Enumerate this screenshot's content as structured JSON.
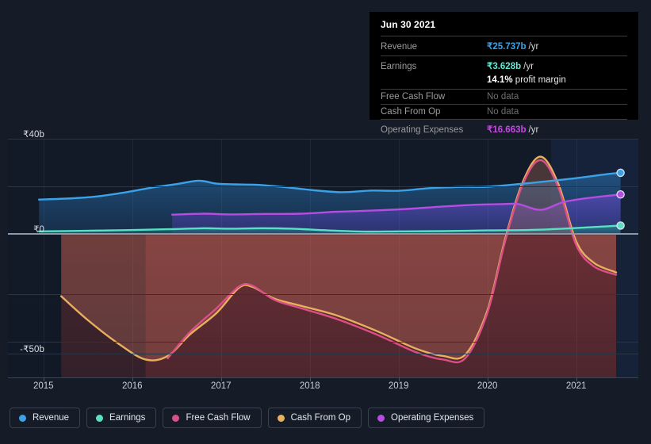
{
  "tooltip": {
    "date": "Jun 30 2021",
    "rows": [
      {
        "label": "Revenue",
        "value": "₹25.737b",
        "unit": "/yr",
        "color": "#3ba2e8",
        "nodata": false
      },
      {
        "label": "Earnings",
        "value": "₹3.628b",
        "unit": "/yr",
        "color": "#5eead4",
        "nodata": false
      },
      {
        "label": "Free Cash Flow",
        "value": "No data",
        "unit": "",
        "color": "#6e6e6e",
        "nodata": true
      },
      {
        "label": "Cash From Op",
        "value": "No data",
        "unit": "",
        "color": "#6e6e6e",
        "nodata": true
      },
      {
        "label": "Operating Expenses",
        "value": "₹16.663b",
        "unit": "/yr",
        "color": "#c44ae0",
        "nodata": false
      }
    ],
    "margin_value": "14.1%",
    "margin_label": "profit margin"
  },
  "legend": [
    {
      "label": "Revenue",
      "color": "#3ba2e8"
    },
    {
      "label": "Earnings",
      "color": "#57e0c4"
    },
    {
      "label": "Free Cash Flow",
      "color": "#da4f85"
    },
    {
      "label": "Cash From Op",
      "color": "#e8b05e"
    },
    {
      "label": "Operating Expenses",
      "color": "#b44de0"
    }
  ],
  "chart_data": {
    "type": "area",
    "title": "",
    "xlabel": "",
    "ylabel": "",
    "currency": "₹",
    "unit": "b",
    "grid": true,
    "legend_position": "bottom",
    "ylim": [
      -60,
      40
    ],
    "xlim": [
      2014.6,
      2021.7
    ],
    "y_ticks": [
      {
        "value": 40,
        "label": "₹40b"
      },
      {
        "value": 20,
        "label": ""
      },
      {
        "value": 0,
        "label": "₹0"
      },
      {
        "value": -25,
        "label": ""
      },
      {
        "value": -45,
        "label": ""
      },
      {
        "value": -50,
        "label": "-₹50b"
      }
    ],
    "x_ticks": [
      {
        "value": 2015,
        "label": "2015"
      },
      {
        "value": 2016,
        "label": "2016"
      },
      {
        "value": 2017,
        "label": "2017"
      },
      {
        "value": 2018,
        "label": "2018"
      },
      {
        "value": 2019,
        "label": "2019"
      },
      {
        "value": 2020,
        "label": "2020"
      },
      {
        "value": 2021,
        "label": "2021"
      }
    ],
    "forecast_region_start": 2020.5,
    "series": [
      {
        "name": "Revenue",
        "color": "#3ba2e8",
        "fill": "rgba(40,110,175,0.42)",
        "endpoint": true,
        "x": [
          2014.95,
          2015.3,
          2015.6,
          2015.9,
          2016.2,
          2016.5,
          2016.75,
          2016.95,
          2017.15,
          2017.4,
          2017.7,
          2018.0,
          2018.35,
          2018.7,
          2019.0,
          2019.35,
          2019.7,
          2020.0,
          2020.35,
          2020.7,
          2021.0,
          2021.35,
          2021.5
        ],
        "values": [
          14.5,
          15.0,
          15.8,
          17.4,
          19.4,
          21.0,
          22.4,
          21.2,
          20.9,
          20.7,
          19.8,
          18.6,
          17.6,
          18.3,
          18.2,
          19.3,
          19.8,
          19.9,
          21.0,
          22.3,
          23.5,
          25.2,
          25.737
        ]
      },
      {
        "name": "Earnings",
        "color": "#57e0c4",
        "fill": "rgba(38,120,126,0.45)",
        "endpoint": true,
        "x": [
          2014.95,
          2015.4,
          2015.9,
          2016.4,
          2016.8,
          2017.1,
          2017.45,
          2017.8,
          2018.2,
          2018.6,
          2019.0,
          2019.5,
          2020.0,
          2020.5,
          2021.0,
          2021.5
        ],
        "values": [
          1.2,
          1.4,
          1.7,
          2.1,
          2.5,
          2.3,
          2.5,
          2.3,
          1.6,
          1.1,
          1.2,
          1.3,
          1.6,
          1.8,
          2.6,
          3.628
        ]
      },
      {
        "name": "Operating Expenses",
        "color": "#b44de0",
        "fill": "rgba(72,58,150,0.55)",
        "endpoint": true,
        "x": [
          2016.45,
          2016.8,
          2017.1,
          2017.5,
          2017.9,
          2018.3,
          2018.7,
          2019.1,
          2019.5,
          2019.9,
          2020.15,
          2020.35,
          2020.6,
          2020.85,
          2021.1,
          2021.5
        ],
        "values": [
          8.2,
          8.6,
          8.3,
          8.5,
          8.6,
          9.4,
          9.9,
          10.6,
          11.6,
          12.4,
          12.6,
          12.6,
          10.2,
          13.4,
          15.0,
          16.663
        ]
      },
      {
        "name": "Cash From Op",
        "color": "#e8b05e",
        "fill": "none",
        "endpoint": false,
        "x": [
          2015.2,
          2015.5,
          2015.85,
          2016.15,
          2016.4,
          2016.65,
          2016.95,
          2017.2,
          2017.35,
          2017.6,
          2017.9,
          2018.3,
          2018.75,
          2019.2,
          2019.5,
          2019.75,
          2020.0,
          2020.2,
          2020.4,
          2020.6,
          2020.8,
          2021.0,
          2021.2,
          2021.45
        ],
        "values": [
          -26.0,
          -36.0,
          -46.0,
          -52.5,
          -51.0,
          -42.0,
          -33.0,
          -22.5,
          -22.0,
          -27.0,
          -30.0,
          -34.0,
          -40.5,
          -48.0,
          -51.0,
          -50.5,
          -32.0,
          -2.0,
          22.0,
          32.5,
          21.0,
          -3.0,
          -12.0,
          -16.0
        ]
      },
      {
        "name": "Free Cash Flow",
        "color": "#da4f85",
        "fill": "none",
        "endpoint": false,
        "x": [
          2016.4,
          2016.65,
          2016.95,
          2017.2,
          2017.35,
          2017.6,
          2017.9,
          2018.3,
          2018.75,
          2019.2,
          2019.5,
          2019.75,
          2020.0,
          2020.2,
          2020.4,
          2020.6,
          2020.8,
          2021.0,
          2021.2,
          2021.45
        ],
        "values": [
          -52.0,
          -41.0,
          -31.0,
          -22.0,
          -21.5,
          -27.5,
          -31.0,
          -35.5,
          -42.0,
          -49.5,
          -52.5,
          -52.0,
          -33.0,
          -3.0,
          21.0,
          31.0,
          19.5,
          -4.5,
          -13.5,
          -17.0
        ]
      }
    ],
    "negative_band": {
      "color_left": "#3d2227",
      "color_right": "#5c2a30",
      "x_start": 2015.2,
      "x_split": 2016.15,
      "x_end": 2021.45
    }
  }
}
